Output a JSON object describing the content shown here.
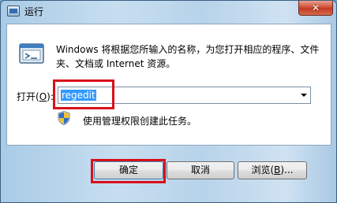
{
  "window": {
    "title": "运行",
    "close_glyph": "✕",
    "icon": "run-dialog-icon"
  },
  "dialog": {
    "description": "Windows 将根据您所输入的名称，为您打开相应的程序、文件夹、文档或 Internet 资源。",
    "open_label_prefix": "打开(",
    "open_label_key": "O",
    "open_label_suffix": "):",
    "input_value": "regedit",
    "admin_note": "使用管理权限创建此任务。",
    "admin_icon": "uac-shield-icon"
  },
  "buttons": {
    "ok": "确定",
    "cancel": "取消",
    "browse_prefix": "浏览(",
    "browse_key": "B",
    "browse_suffix": ")..."
  },
  "colors": {
    "highlight": "#d8101b",
    "selection": "#3399ff",
    "close": "#c23a24"
  }
}
